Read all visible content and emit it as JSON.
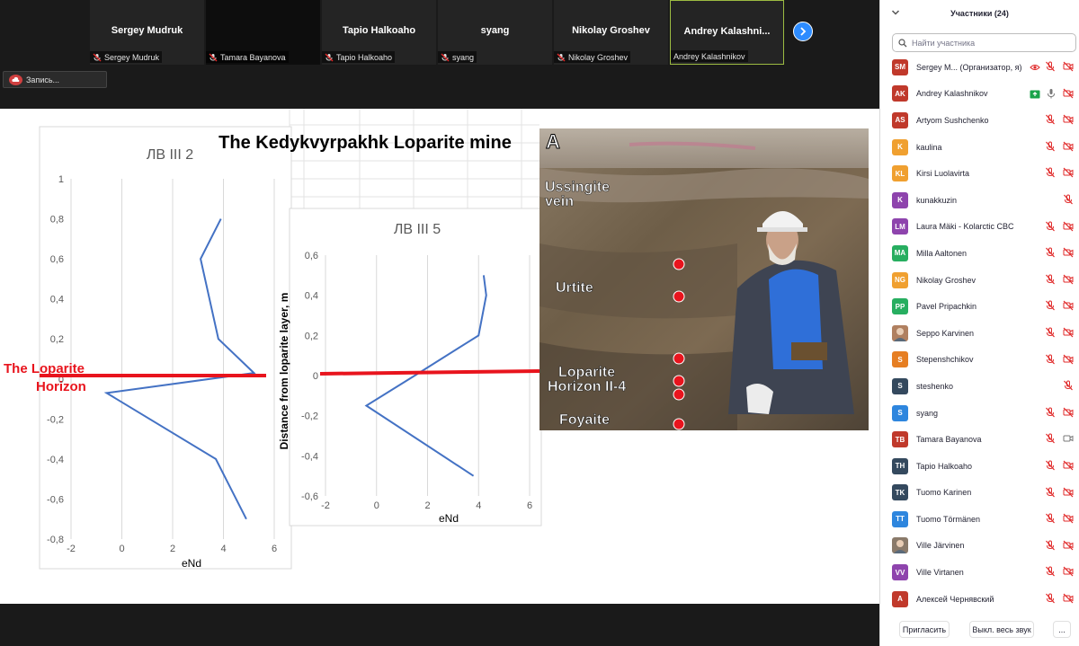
{
  "video_strip": {
    "tiles": [
      {
        "title": "Sergey Mudruk",
        "label": "Sergey Mudruk"
      },
      {
        "title": "",
        "label": "Tamara Bayanova"
      },
      {
        "title": "Tapio Halkoaho",
        "label": "Tapio Halkoaho"
      },
      {
        "title": "syang",
        "label": "syang"
      },
      {
        "title": "Nikolay Groshev",
        "label": "Nikolay Groshev"
      },
      {
        "title": "Andrey  Kalashni...",
        "label": "Andrey Kalashnikov"
      }
    ],
    "record_label": "Запись..."
  },
  "slide": {
    "title": "The Kedykvyrpakhk Loparite mine",
    "horizon_label_line1": "The Loparite",
    "horizon_label_line2": "Horizon",
    "y_axis_label": "Distance from loparite layer, m",
    "photo_panel_letter": "A",
    "photo_labels": [
      "Ussingite",
      "vein",
      "Urtite",
      "Loparite",
      "Horizon II-4",
      "Foyaite"
    ],
    "colors": {
      "horizon_line": "#e8141d",
      "series": "#4472c4",
      "grid": "#d9d9d9"
    }
  },
  "chart_data": [
    {
      "type": "line",
      "title": "ЛВ III 2",
      "xlabel": "eNd",
      "ylabel": "",
      "xlim": [
        -2,
        6
      ],
      "ylim": [
        -0.8,
        1
      ],
      "xticks": [
        "-2",
        "0",
        "2",
        "4",
        "6"
      ],
      "yticks": [
        "1",
        "0,8",
        "0,6",
        "0,4",
        "0,2",
        "0",
        "-0,2",
        "-0,4",
        "-0,6",
        "-0,8"
      ],
      "grid": true,
      "series": [
        {
          "x": [
            3.9,
            3.1,
            3.8,
            5.2,
            -0.6,
            3.7,
            4.9
          ],
          "y": [
            0.8,
            0.6,
            0.2,
            0.03,
            -0.07,
            -0.4,
            -0.7
          ]
        }
      ]
    },
    {
      "type": "line",
      "title": "ЛВ III 5",
      "xlabel": "eNd",
      "ylabel": "Distance from loparite layer, m",
      "xlim": [
        -2,
        6
      ],
      "ylim": [
        -0.6,
        0.6
      ],
      "xticks": [
        "-2",
        "0",
        "2",
        "4",
        "6"
      ],
      "yticks": [
        "0,6",
        "0,4",
        "0,2",
        "0",
        "-0,2",
        "-0,4",
        "-0,6"
      ],
      "grid": true,
      "series": [
        {
          "x": [
            4.2,
            4.3,
            4.0,
            1.5,
            -0.4,
            3.8
          ],
          "y": [
            0.5,
            0.4,
            0.2,
            0.0,
            -0.15,
            -0.5
          ]
        }
      ]
    }
  ],
  "participants": {
    "title": "Участники (24)",
    "search_placeholder": "Найти участника",
    "list": [
      {
        "initials": "SM",
        "name": "Sergey M... (Организатор, я)",
        "color": "#c0392b",
        "icons": [
          "share",
          "mic-off",
          "cam-off"
        ]
      },
      {
        "initials": "AK",
        "name": "Andrey Kalashnikov",
        "color": "#c0392b",
        "icons": [
          "screen",
          "mic-on",
          "cam-off"
        ]
      },
      {
        "initials": "AS",
        "name": "Artyom Sushchenko",
        "color": "#c0392b",
        "icons": [
          "mic-off",
          "cam-off"
        ]
      },
      {
        "initials": "K",
        "name": "kaulina",
        "color": "#f0a030",
        "icons": [
          "mic-off",
          "cam-off"
        ]
      },
      {
        "initials": "KL",
        "name": "Kirsi Luolavirta",
        "color": "#f0a030",
        "icons": [
          "mic-off",
          "cam-off"
        ]
      },
      {
        "initials": "K",
        "name": "kunakkuzin",
        "color": "#8e44ad",
        "icons": [
          "mic-off-only"
        ]
      },
      {
        "initials": "LM",
        "name": "Laura Mäki - Kolarctic CBC",
        "color": "#8e44ad",
        "icons": [
          "mic-off",
          "cam-off"
        ]
      },
      {
        "initials": "MA",
        "name": "Milla Aaltonen",
        "color": "#27ae60",
        "icons": [
          "mic-off",
          "cam-off"
        ]
      },
      {
        "initials": "NG",
        "name": "Nikolay Groshev",
        "color": "#f0a030",
        "icons": [
          "mic-off",
          "cam-off"
        ]
      },
      {
        "initials": "PP",
        "name": "Pavel Pripachkin",
        "color": "#27ae60",
        "icons": [
          "mic-off",
          "cam-off"
        ]
      },
      {
        "initials": "",
        "name": "Seppo Karvinen",
        "color": "#b08060",
        "icons": [
          "mic-off",
          "cam-off"
        ]
      },
      {
        "initials": "S",
        "name": "Stepenshchikov",
        "color": "#e67e22",
        "icons": [
          "mic-off",
          "cam-off"
        ]
      },
      {
        "initials": "S",
        "name": "steshenko",
        "color": "#34495e",
        "icons": [
          "mic-off-only"
        ]
      },
      {
        "initials": "S",
        "name": "syang",
        "color": "#2e86de",
        "icons": [
          "mic-off",
          "cam-off"
        ]
      },
      {
        "initials": "TB",
        "name": "Tamara Bayanova",
        "color": "#c0392b",
        "icons": [
          "mic-off",
          "cam-on"
        ]
      },
      {
        "initials": "TH",
        "name": "Tapio Halkoaho",
        "color": "#34495e",
        "icons": [
          "mic-off",
          "cam-off"
        ]
      },
      {
        "initials": "TK",
        "name": "Tuomo Karinen",
        "color": "#34495e",
        "icons": [
          "mic-off",
          "cam-off"
        ]
      },
      {
        "initials": "TT",
        "name": "Tuomo Törmänen",
        "color": "#2e86de",
        "icons": [
          "mic-off",
          "cam-off"
        ]
      },
      {
        "initials": "",
        "name": "Ville Järvinen",
        "color": "#8a7a6a",
        "icons": [
          "mic-off",
          "cam-off"
        ]
      },
      {
        "initials": "VV",
        "name": "Ville Virtanen",
        "color": "#8e44ad",
        "icons": [
          "mic-off",
          "cam-off"
        ]
      },
      {
        "initials": "A",
        "name": "Алексей Чернявский",
        "color": "#c0392b",
        "icons": [
          "mic-off",
          "cam-off"
        ]
      }
    ],
    "invite_label": "Пригласить",
    "mute_all_label": "Выкл. весь звук",
    "more_label": "..."
  }
}
